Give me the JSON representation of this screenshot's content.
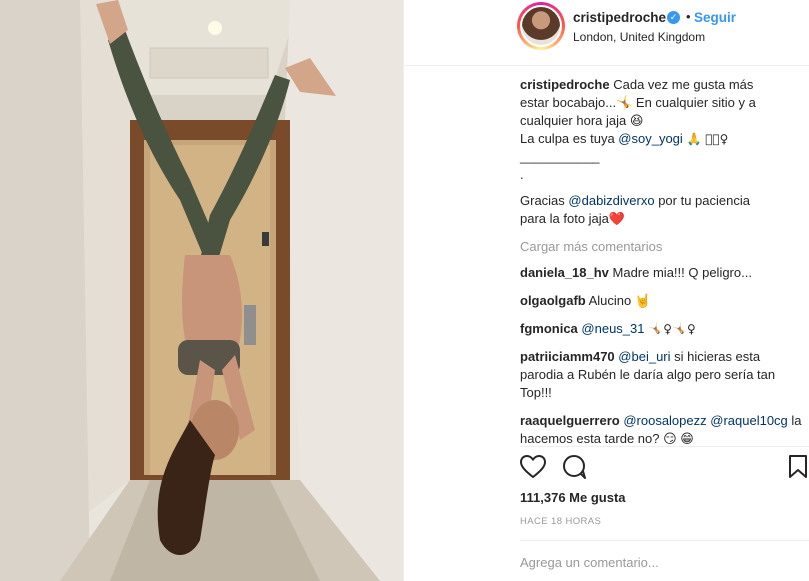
{
  "post": {
    "username": "cristipedroche",
    "verified_icon": "check-icon",
    "follow_label": "Seguir",
    "location": "London, United Kingdom"
  },
  "caption": {
    "username": "cristipedroche",
    "line1": "Cada vez me gusta más",
    "line2": "estar bocabajo...🤸 En cualquier sitio y a",
    "line3": "cualquier hora jaja 😆",
    "line4_text": "La culpa es tuya ",
    "line4_mention": "@soy_yogi",
    "line4_emoji": "🙏 🏻🏻♀",
    "line5": "___________",
    "line6": ".",
    "line7_text": "Gracias ",
    "line7_mention": "@dabizdiverxo",
    "line7_rest": " por tu paciencia",
    "line8": "para la foto jaja❤️"
  },
  "load_more_label": "Cargar más comentarios",
  "comments": [
    {
      "user": "daniela_18_hv",
      "text": "Madre mia!!! Q peligro..."
    },
    {
      "user": "olgaolgafb",
      "text": "Alucino 🤘"
    },
    {
      "user": "fgmonica",
      "mention": "@neus_31",
      "text": " 🤸🏻♀🤸🏻♀"
    },
    {
      "user": "patriiciamm470",
      "mention": "@bei_uri",
      "text": " si hicieras esta parodia a Rubén le daría algo pero sería tan Top!!!"
    },
    {
      "user": "raaquelguerrero",
      "mention": "@roosalopezz",
      "mention2": "@raquel10cg",
      "text": " la hacemos esta tarde no? 😏 😁"
    }
  ],
  "likes": "111,376 Me gusta",
  "timestamp": "HACE 18 HORAS",
  "comment_input": {
    "placeholder": "Agrega un comentario..."
  },
  "icons": {
    "like": "heart-icon",
    "comment": "speech-bubble-icon",
    "save": "bookmark-icon"
  }
}
